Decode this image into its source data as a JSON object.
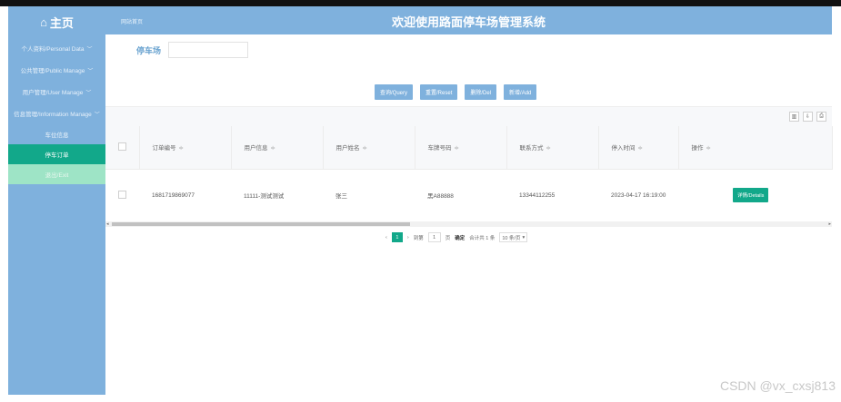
{
  "sidebar": {
    "logo": "主页",
    "items": [
      {
        "label": "个人资料/Personal Data"
      },
      {
        "label": "公共管理/Public Manage"
      },
      {
        "label": "用户管理/User Manage"
      },
      {
        "label": "信息管理/Information Manage"
      }
    ],
    "subitems": [
      {
        "label": "车位信息"
      },
      {
        "label": "停车订单"
      }
    ],
    "exit": "退出/Exit"
  },
  "header": {
    "breadcrumb": "网站首页",
    "title": "欢迎使用路面停车场管理系统"
  },
  "search": {
    "label": "停车场",
    "value": ""
  },
  "buttons": {
    "query": "查询/Query",
    "reset": "重置/Reset",
    "delete": "删除/Del",
    "add": "新增/Add"
  },
  "table": {
    "columns": [
      "订单编号",
      "用户信息",
      "用户姓名",
      "车牌号码",
      "联系方式",
      "停入时间",
      "操作"
    ],
    "sort_glyph": "≑",
    "rows": [
      {
        "order_no": "1681719869077",
        "user_info": "11111-测试测试",
        "user_name": "张三",
        "plate": "黑A88888",
        "phone": "13344112255",
        "park_time": "2023-04-17 16:19:00",
        "action": "详情/Details"
      }
    ]
  },
  "pager": {
    "current": "1",
    "goto_label": "到第",
    "goto_value": "1",
    "page_unit": "页",
    "confirm": "确定",
    "total": "合计共 1 条",
    "page_size": "10 条/页"
  },
  "watermark": "CSDN @vx_cxsj813"
}
